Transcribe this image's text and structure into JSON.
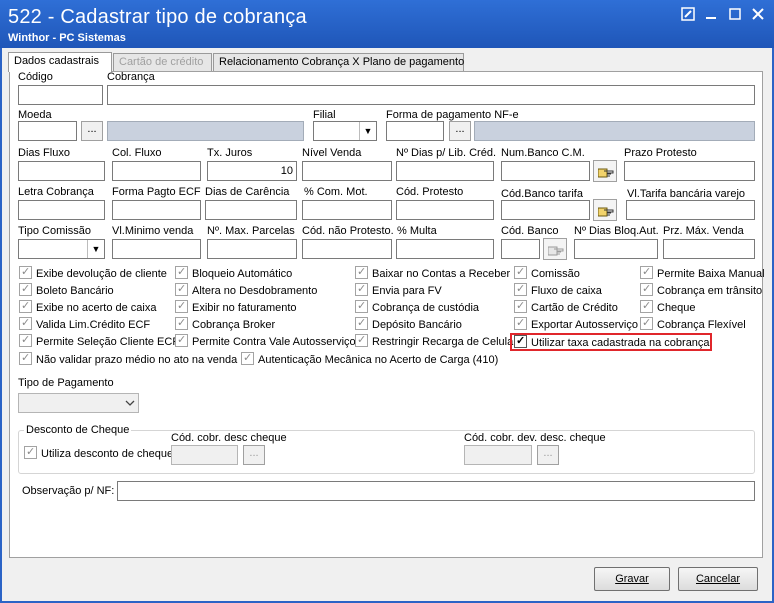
{
  "window": {
    "title": "522 - Cadastrar tipo de cobrança",
    "subtitle": "Winthor - PC Sistemas"
  },
  "tabs": [
    {
      "label": "Dados cadastrais",
      "active": true,
      "enabled": true
    },
    {
      "label": "Cartão de crédito",
      "active": false,
      "enabled": false
    },
    {
      "label": "Relacionamento Cobrança X Plano de pagamento",
      "active": false,
      "enabled": true
    }
  ],
  "fields": {
    "codigo": {
      "label": "Código",
      "value": ""
    },
    "cobranca": {
      "label": "Cobrança",
      "value": ""
    },
    "moeda": {
      "label": "Moeda",
      "value": ""
    },
    "filial": {
      "label": "Filial",
      "value": ""
    },
    "forma_pag_nfe": {
      "label": "Forma de pagamento NF-e",
      "value": ""
    },
    "dias_fluxo": {
      "label": "Dias Fluxo",
      "value": ""
    },
    "col_fluxo": {
      "label": "Col. Fluxo",
      "value": ""
    },
    "tx_juros": {
      "label": "Tx. Juros",
      "value": "10"
    },
    "nivel_venda": {
      "label": "Nível Venda",
      "value": ""
    },
    "n_dias_lib_cred": {
      "label": "Nº Dias p/ Lib. Créd.",
      "value": ""
    },
    "num_banco_cm": {
      "label": "Num.Banco C.M.",
      "value": ""
    },
    "prazo_protesto": {
      "label": "Prazo Protesto",
      "value": ""
    },
    "letra_cobranca": {
      "label": "Letra Cobrança",
      "value": ""
    },
    "forma_pagto_ecf": {
      "label": "Forma Pagto ECF",
      "value": ""
    },
    "dias_carencia": {
      "label": "Dias de Carência",
      "value": ""
    },
    "com_mot": {
      "label": "% Com. Mot.",
      "value": ""
    },
    "cod_protesto": {
      "label": "Cód. Protesto",
      "value": ""
    },
    "cod_banco_tarifa": {
      "label": "Cód.Banco tarifa",
      "value": ""
    },
    "vl_tarifa": {
      "label": "Vl.Tarifa bancária varejo",
      "value": ""
    },
    "tipo_comissao": {
      "label": "Tipo Comissão",
      "value": ""
    },
    "vl_minimo_venda": {
      "label": "Vl.Minimo venda",
      "value": ""
    },
    "n_max_parcelas": {
      "label": "Nº. Max. Parcelas",
      "value": ""
    },
    "cod_nao_protesto": {
      "label": "Cód. não Protesto.",
      "value": ""
    },
    "multa": {
      "label": "% Multa",
      "value": ""
    },
    "cod_banco": {
      "label": "Cód. Banco",
      "value": ""
    },
    "n_dias_bloq_aut": {
      "label": "Nº Dias Bloq.Aut.",
      "value": ""
    },
    "prz_max_venda": {
      "label": "Prz. Máx. Venda",
      "value": ""
    },
    "tipo_pagamento": {
      "label": "Tipo de Pagamento",
      "value": ""
    },
    "observacao_nf": {
      "label": "Observação p/ NF:",
      "value": ""
    }
  },
  "checkboxes": {
    "col1": [
      "Exibe devolução de cliente",
      "Boleto Bancário",
      "Exibe no acerto de caixa",
      "Valida Lim.Crédito ECF",
      "Permite Seleção Cliente ECF",
      "Não validar prazo médio no ato na venda"
    ],
    "col2": [
      "Bloqueio Automático",
      "Altera no Desdobramento",
      "Exibir no faturamento",
      "Cobrança Broker",
      "Permite Contra Vale Autosserviço",
      "Autenticação Mecânica no Acerto de Carga (410)"
    ],
    "col3": [
      "Baixar no Contas a Receber",
      "Envia para FV",
      "Cobrança de custódia",
      "Depósito Bancário",
      "Restringir Recarga de Celular"
    ],
    "col4": [
      "Comissão",
      "Fluxo de caixa",
      "Cartão de Crédito",
      "Exportar Autosserviço",
      "Utilizar taxa cadastrada na cobrança"
    ],
    "col5": [
      "Permite Baixa Manual",
      "Cobrança em trânsito",
      "Cheque",
      "Cobrança Flexível"
    ]
  },
  "desconto_cheque": {
    "title": "Desconto de Cheque",
    "checkbox_label": "Utiliza desconto de cheque",
    "cod_desc_label": "Cód. cobr. desc cheque",
    "cod_dev_label": "Cód. cobr. dev. desc. cheque"
  },
  "buttons": {
    "dots": "...",
    "gravar": "Gravar",
    "cancelar": "Cancelar"
  },
  "colors": {
    "titlebar": "#2f6fd6",
    "highlight": "#e0262b"
  }
}
